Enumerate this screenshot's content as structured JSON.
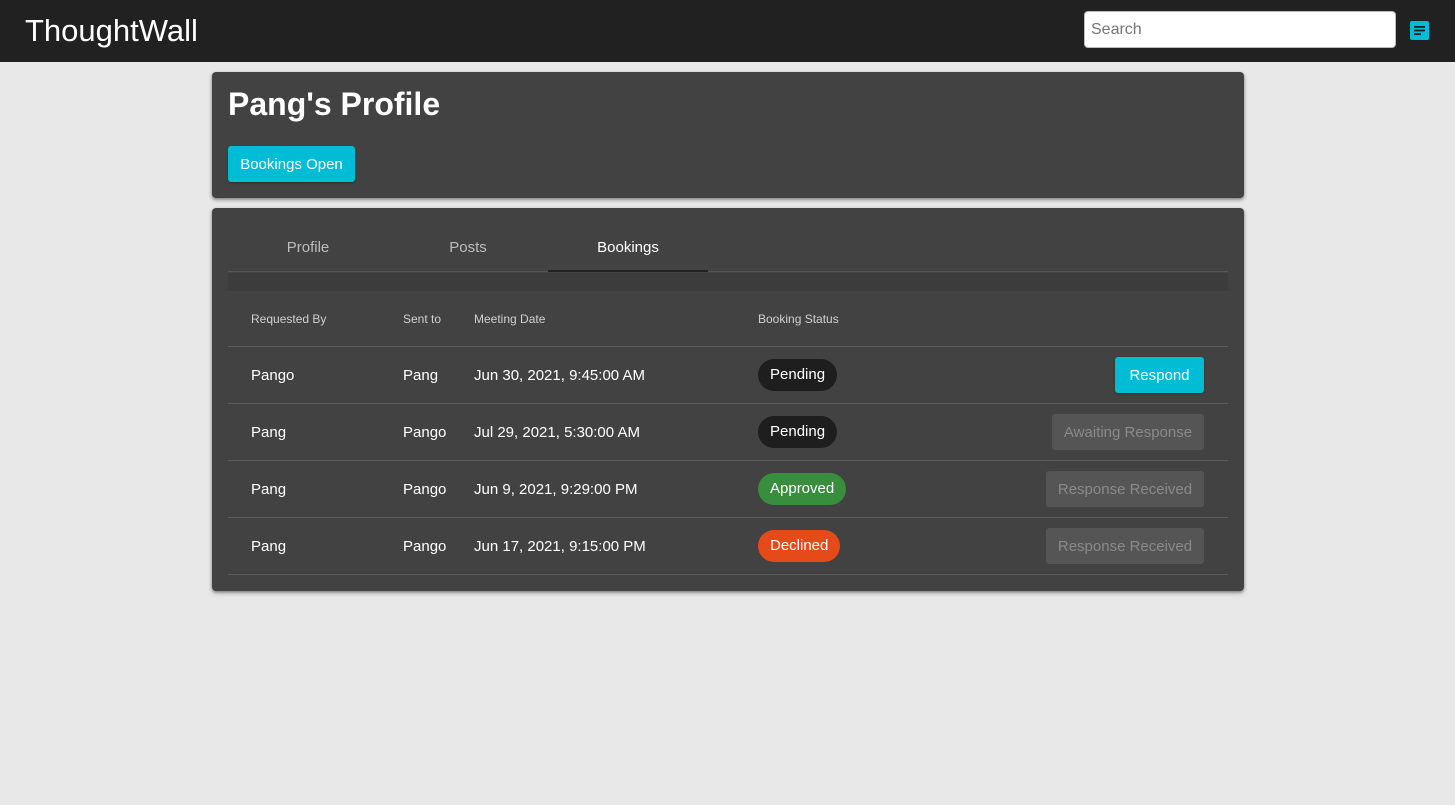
{
  "app": {
    "title": "ThoughtWall"
  },
  "search": {
    "placeholder": "Search"
  },
  "icons": {
    "nav": "notes-icon",
    "accent": "#00bcd4"
  },
  "profile": {
    "title": "Pang's Profile",
    "bookings_button": "Bookings Open"
  },
  "tabs": [
    {
      "label": "Profile",
      "active": false
    },
    {
      "label": "Posts",
      "active": false
    },
    {
      "label": "Bookings",
      "active": true
    }
  ],
  "table": {
    "headers": [
      "Requested By",
      "Sent to",
      "Meeting Date",
      "Booking Status"
    ],
    "rows": [
      {
        "requested_by": "Pango",
        "sent_to": "Pang",
        "date": "Jun 30, 2021, 9:45:00 AM",
        "status": "Pending",
        "status_color": "#1e1e1e",
        "action": "Respond",
        "action_enabled": true
      },
      {
        "requested_by": "Pang",
        "sent_to": "Pango",
        "date": "Jul 29, 2021, 5:30:00 AM",
        "status": "Pending",
        "status_color": "#1e1e1e",
        "action": "Awaiting Response",
        "action_enabled": false
      },
      {
        "requested_by": "Pang",
        "sent_to": "Pango",
        "date": "Jun 9, 2021, 9:29:00 PM",
        "status": "Approved",
        "status_color": "#388e3c",
        "action": "Response Received",
        "action_enabled": false
      },
      {
        "requested_by": "Pang",
        "sent_to": "Pango",
        "date": "Jun 17, 2021, 9:15:00 PM",
        "status": "Declined",
        "status_color": "#e64a19",
        "action": "Response Received",
        "action_enabled": false
      }
    ]
  }
}
